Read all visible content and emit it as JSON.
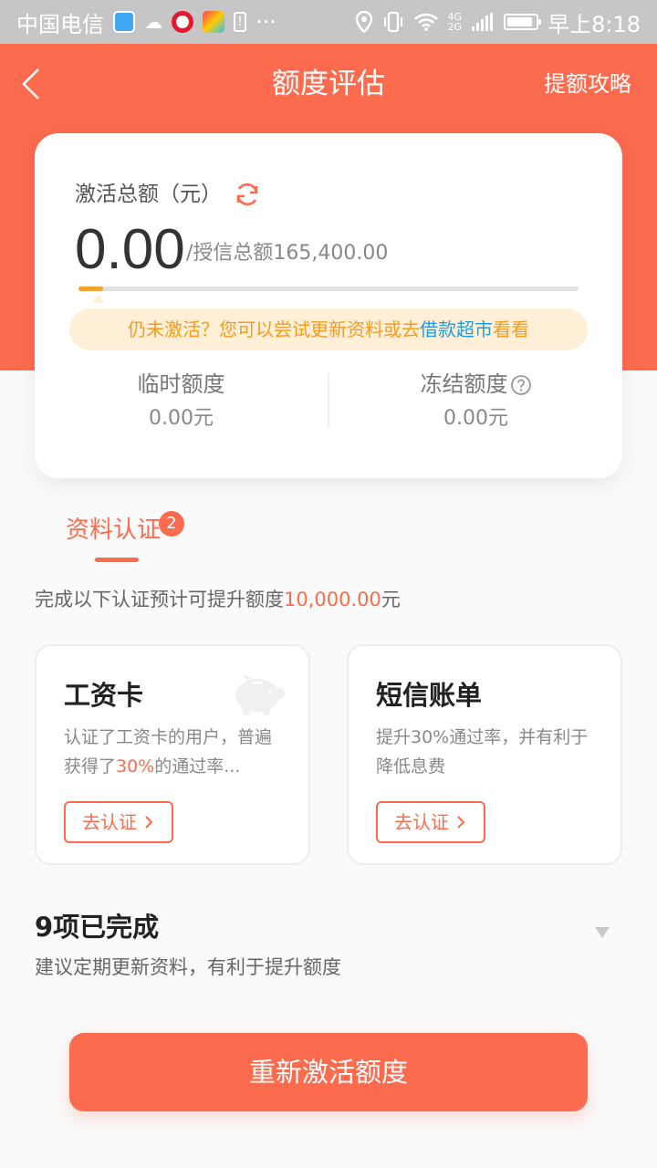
{
  "status_bar": {
    "carrier": "中国电信",
    "network": [
      "4G",
      "2G"
    ],
    "time": "早上8:18",
    "battery_level": 0.8,
    "overflow": "···"
  },
  "header": {
    "title": "额度评估",
    "right_link": "提额攻略",
    "bg_color": "#fd6b4e"
  },
  "credit": {
    "activated_label": "激活总额（元）",
    "activated_amount": "0.00",
    "total_text": "/授信总额165,400.00",
    "progress": 0.05,
    "tip_prefix": "仍未激活？您可以尝试更新资料或去",
    "tip_link": "借款超市",
    "tip_suffix": "看看",
    "temp_label": "临时额度",
    "temp_value": "0.00元",
    "frozen_label": "冻结额度",
    "frozen_value": "0.00元"
  },
  "section": {
    "tab_label": "资料认证",
    "badge_count": "2",
    "desc_prefix": "完成以下认证预计可提升额度",
    "desc_amount": "10,000.00",
    "desc_suffix": "元"
  },
  "verify_cards": [
    {
      "title": "工资卡",
      "desc_a": "认证了工资卡的用户，普遍获得了",
      "desc_hl": "30%",
      "desc_b": "的通过率...",
      "button": "去认证",
      "icon": "piggy-bank-icon"
    },
    {
      "title": "短信账单",
      "desc": "提升30%通过率，并有利于降低息费",
      "button": "去认证"
    }
  ],
  "completed": {
    "title": "9项已完成",
    "desc": "建议定期更新资料，有利于提升额度"
  },
  "main_button": "重新激活额度",
  "colors": {
    "accent": "#fd6b4e",
    "warning_text": "#f59b1e",
    "warning_bg": "#ffefd6",
    "link": "#1d9de0",
    "progress": "#f7a22e"
  }
}
